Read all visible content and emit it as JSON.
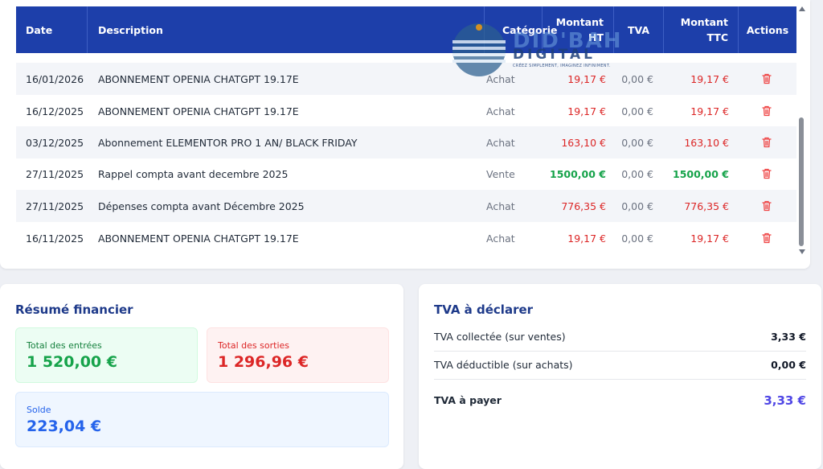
{
  "table": {
    "headers": {
      "date": "Date",
      "description": "Description",
      "category": "Catégorie",
      "montant_ht_line1": "Montant",
      "montant_ht_line2": "HT",
      "tva": "TVA",
      "montant_ttc_line1": "Montant",
      "montant_ttc_line2": "TTC",
      "actions": "Actions"
    },
    "rows": [
      {
        "date": "16/01/2026",
        "description": "ABONNEMENT OPENIA CHATGPT 19.17E",
        "category": "Achat",
        "ht": "19,17 €",
        "tva": "0,00 €",
        "ttc": "19,17 €",
        "type": "expense"
      },
      {
        "date": "16/12/2025",
        "description": "ABONNEMENT OPENIA CHATGPT 19.17E",
        "category": "Achat",
        "ht": "19,17 €",
        "tva": "0,00 €",
        "ttc": "19,17 €",
        "type": "expense"
      },
      {
        "date": "03/12/2025",
        "description": "Abonnement ELEMENTOR PRO 1 AN/ BLACK FRIDAY",
        "category": "Achat",
        "ht": "163,10 €",
        "tva": "0,00 €",
        "ttc": "163,10 €",
        "type": "expense"
      },
      {
        "date": "27/11/2025",
        "description": "Rappel compta avant decembre 2025",
        "category": "Vente",
        "ht": "1500,00 €",
        "tva": "0,00 €",
        "ttc": "1500,00 €",
        "type": "income"
      },
      {
        "date": "27/11/2025",
        "description": "Dépenses compta avant Décembre 2025",
        "category": "Achat",
        "ht": "776,35 €",
        "tva": "0,00 €",
        "ttc": "776,35 €",
        "type": "expense"
      },
      {
        "date": "16/11/2025",
        "description": "ABONNEMENT OPENIA CHATGPT 19.17E",
        "category": "Achat",
        "ht": "19,17 €",
        "tva": "0,00 €",
        "ttc": "19,17 €",
        "type": "expense"
      }
    ],
    "action_icon": "trash-icon"
  },
  "watermark": {
    "line1": "DID'BAH",
    "line2": "DIGITAL",
    "tagline": "CRÉEZ SIMPLEMENT, IMAGINEZ INFINIMENT."
  },
  "summary": {
    "title": "Résumé financier",
    "entries_label": "Total des entrées",
    "entries_value": "1 520,00 €",
    "exits_label": "Total des sorties",
    "exits_value": "1 296,96 €",
    "balance_label": "Solde",
    "balance_value": "223,04 €"
  },
  "tva": {
    "title": "TVA à déclarer",
    "collected_label": "TVA collectée (sur ventes)",
    "collected_value": "3,33 €",
    "deductible_label": "TVA déductible (sur achats)",
    "deductible_value": "0,00 €",
    "payable_label": "TVA à payer",
    "payable_value": "3,33 €"
  },
  "colors": {
    "header_bg": "#1d3faa",
    "expense": "#dc2626",
    "income": "#16a34a",
    "accent_purple": "#4f46e5",
    "balance": "#2563eb"
  }
}
